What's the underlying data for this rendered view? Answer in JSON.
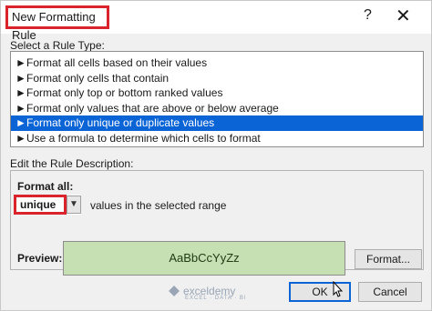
{
  "dialog": {
    "title": "New Formatting Rule",
    "help_glyph": "?",
    "close_glyph": "✕"
  },
  "rule_type": {
    "heading": "Select a Rule Type:",
    "items": [
      {
        "label": "Format all cells based on their values"
      },
      {
        "label": "Format only cells that contain"
      },
      {
        "label": "Format only top or bottom ranked values"
      },
      {
        "label": "Format only values that are above or below average"
      },
      {
        "label": "Format only unique or duplicate values"
      },
      {
        "label": "Use a formula to determine which cells to format"
      }
    ],
    "selected_index": 4,
    "arrow_glyph": "►"
  },
  "description": {
    "heading": "Edit the Rule Description:",
    "format_all_label": "Format all:",
    "format_all_value": "unique",
    "range_text": "values in the selected range",
    "preview_label": "Preview:",
    "preview_text": "AaBbCcYyZz",
    "preview_color": "#c6e0b4"
  },
  "buttons": {
    "format": "Format...",
    "ok": "OK",
    "cancel": "Cancel"
  },
  "watermark": {
    "name": "exceldemy",
    "tagline": "EXCEL · DATA · BI"
  }
}
